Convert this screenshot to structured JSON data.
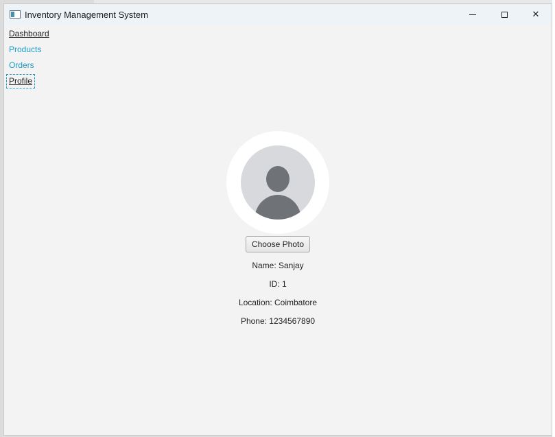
{
  "window": {
    "title": "Inventory Management System",
    "controls": {
      "minimize": "minimize",
      "maximize": "maximize",
      "close": "✕"
    }
  },
  "nav": {
    "items": [
      {
        "label": "Dashboard",
        "state": "visited"
      },
      {
        "label": "Products",
        "state": "link"
      },
      {
        "label": "Orders",
        "state": "link"
      },
      {
        "label": "Profile",
        "state": "focused"
      }
    ]
  },
  "profile": {
    "avatar_icon": "user-avatar-placeholder",
    "choose_photo_label": "Choose Photo",
    "name": "Name: Sanjay",
    "id": "ID: 1",
    "location": "Location: Coimbatore",
    "phone": "Phone: 1234567890"
  },
  "colors": {
    "link": "#1a9bc5",
    "window_bg": "#f3f3f3",
    "titlebar_bg": "#eef3f8",
    "avatar_bg": "#d8d9dc",
    "avatar_figure": "#6f7378"
  }
}
